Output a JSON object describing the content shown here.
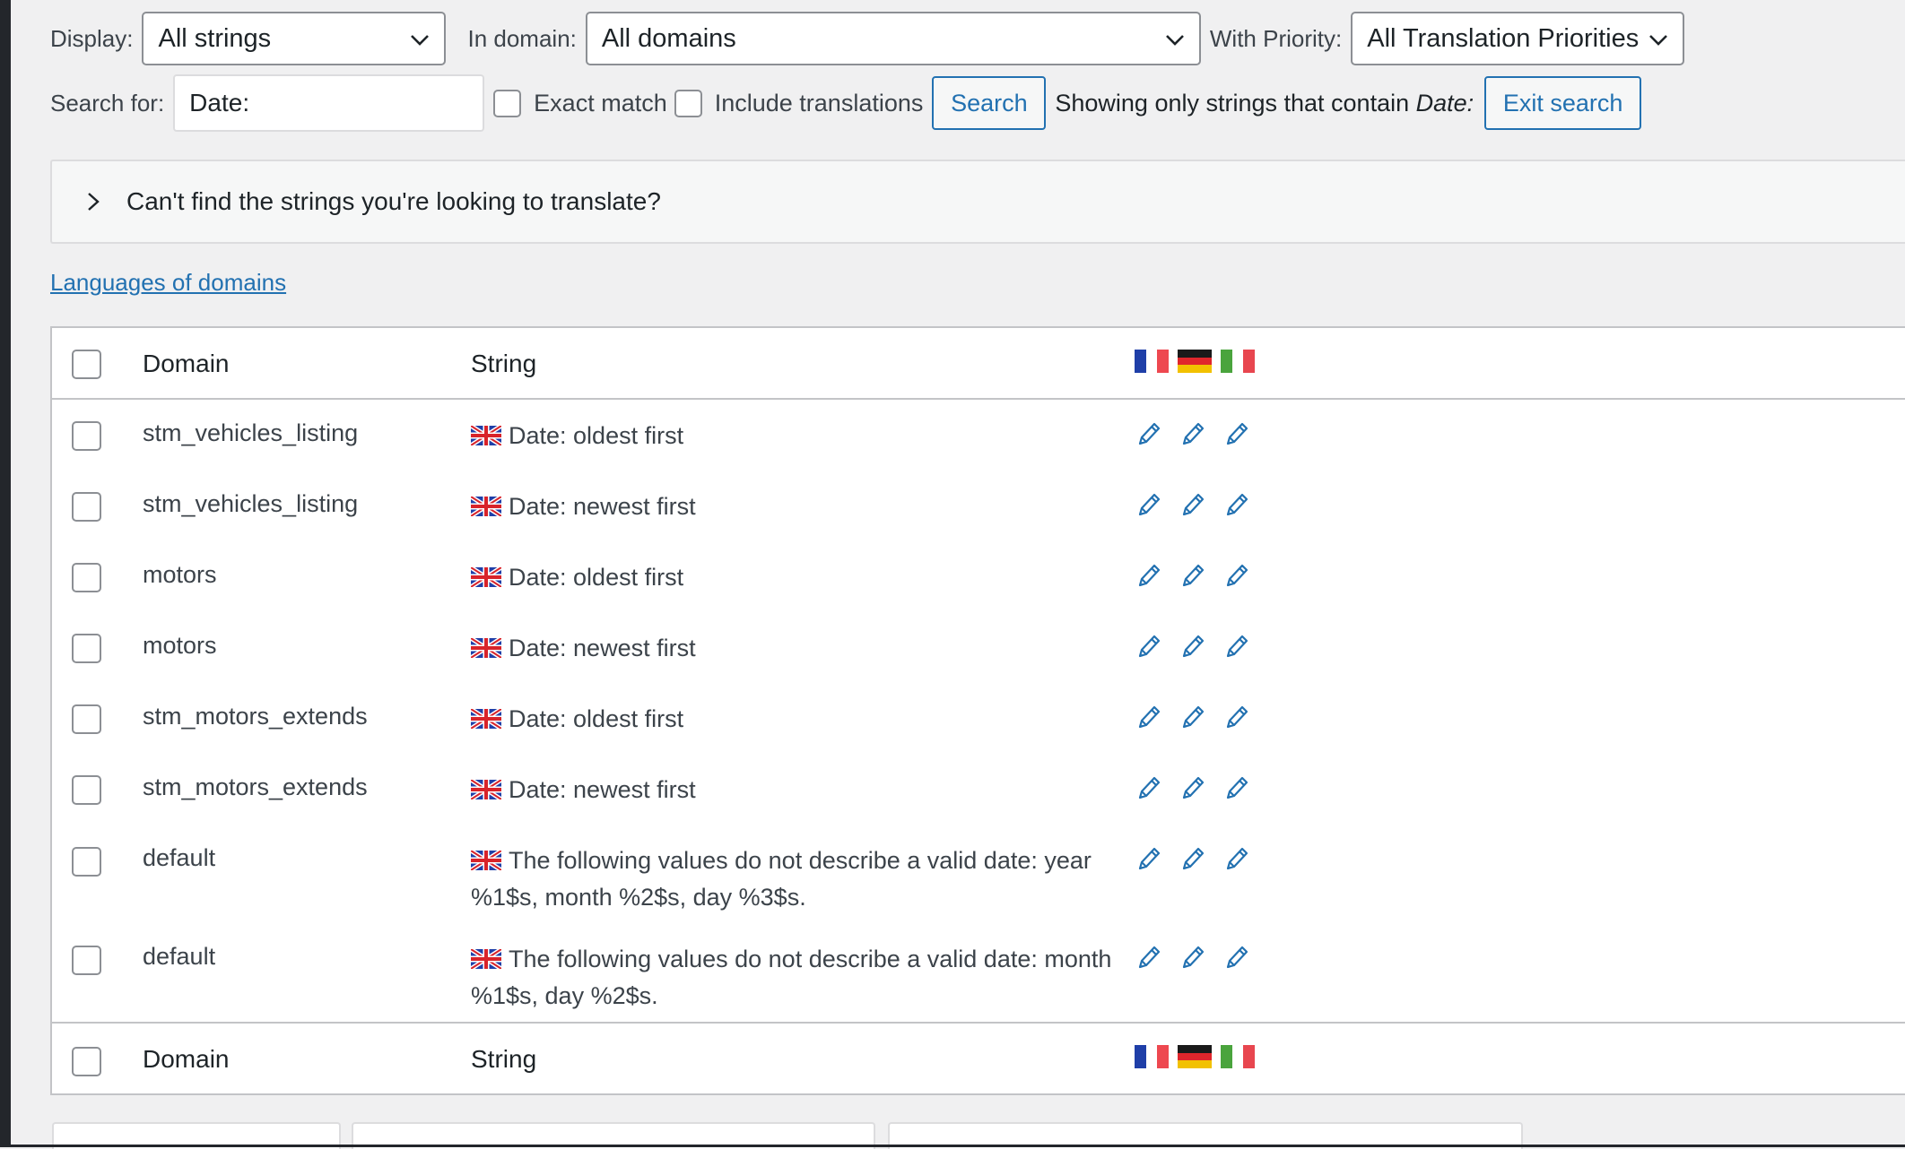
{
  "filters": {
    "display_label": "Display:",
    "display_value": "All strings",
    "domain_label": "In domain:",
    "domain_value": "All domains",
    "priority_label": "With Priority:",
    "priority_value": "All Translation Priorities",
    "search_label": "Search for:",
    "search_value": "Date:",
    "exact_match_label": "Exact match",
    "include_translations_label": "Include translations",
    "search_button": "Search",
    "notice_prefix": "Showing only strings that contain ",
    "notice_term": "Date:",
    "exit_search_button": "Exit search"
  },
  "collapse": {
    "label": "Can't find the strings you're looking to translate?"
  },
  "languages_link": "Languages of domains",
  "table": {
    "col_domain": "Domain",
    "col_string": "String",
    "languages": [
      "fr",
      "de",
      "it"
    ],
    "rows": [
      {
        "domain": "stm_vehicles_listing",
        "string": "Date: oldest first"
      },
      {
        "domain": "stm_vehicles_listing",
        "string": "Date: newest first"
      },
      {
        "domain": "motors",
        "string": "Date: oldest first"
      },
      {
        "domain": "motors",
        "string": "Date: newest first"
      },
      {
        "domain": "stm_motors_extends",
        "string": "Date: oldest first"
      },
      {
        "domain": "stm_motors_extends",
        "string": "Date: newest first"
      },
      {
        "domain": "default",
        "string": "The following values do not describe a valid date: year %1$s, month %2$s, day %3$s."
      },
      {
        "domain": "default",
        "string": "The following values do not describe a valid date: month %1$s, day %2$s."
      }
    ]
  },
  "colors": {
    "accent": "#2271b1",
    "background": "#f0f0f1",
    "border": "#c3c4c7"
  }
}
